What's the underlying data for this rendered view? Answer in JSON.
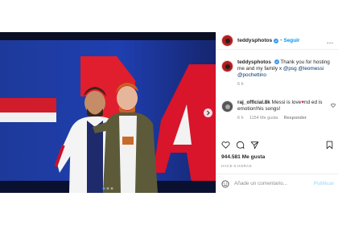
{
  "post": {
    "username": "teddysphotos",
    "follow_label": "Seguir",
    "more_icon": "more-horizontal-icon",
    "caption_text": "Thank you for hosting me and my family x ",
    "caption_mention_1": "@psg",
    "caption_mention_2": "@leomessi",
    "caption_mention_3": "@pochettino",
    "caption_time": "6 h",
    "comment": {
      "username": "raj_official.8k",
      "text_before": "Messi is love",
      "text_after": "nd ed is emotion!his songs!",
      "time": "6 h",
      "likes": "1154 Me gusta",
      "reply_label": "Responder"
    },
    "likes": "944.581 Me gusta",
    "time_ago": "HACE 6 HORAS",
    "add_comment_placeholder": "Añade un comentario...",
    "publish_label": "Publicar"
  },
  "colors": {
    "accent": "#0095f6",
    "verified": "#3897f0",
    "avatar": "#b31d1d",
    "publish_disabled": "#b2dffc"
  },
  "carousel": {
    "slides": 3,
    "active": 1
  }
}
